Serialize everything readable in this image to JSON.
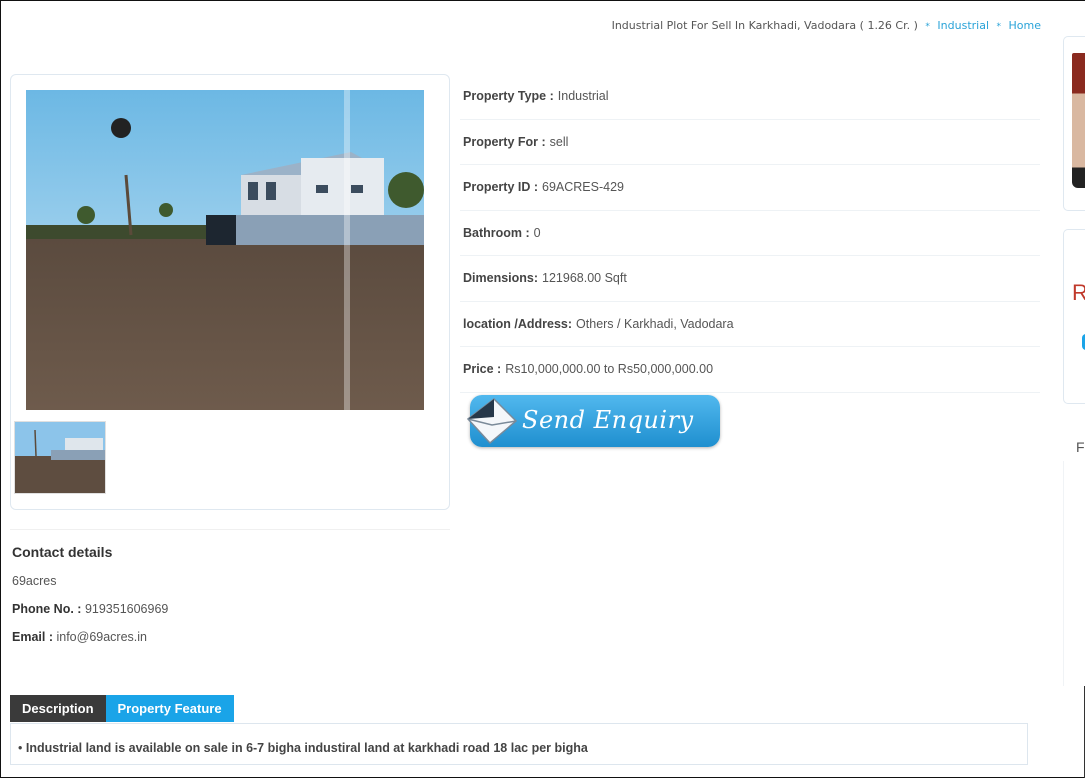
{
  "breadcrumb": {
    "current": "Industrial Plot For Sell In Karkhadi, Vadodara ( 1.26 Cr. )",
    "category": "Industrial",
    "home": "Home"
  },
  "details": [
    {
      "label": "Property Type :",
      "value": "Industrial"
    },
    {
      "label": "Property For :",
      "value": "sell"
    },
    {
      "label": "Property ID :",
      "value": "69ACRES-429"
    },
    {
      "label": "Bathroom :",
      "value": "0"
    },
    {
      "label": "Dimensions:",
      "value": "121968.00 Sqft"
    },
    {
      "label": "location /Address:",
      "value": "Others / Karkhadi, Vadodara"
    },
    {
      "label": "Price :",
      "value": "Rs10,000,000.00 to Rs50,000,000.00"
    }
  ],
  "enquiry": {
    "label": "Send Enquiry"
  },
  "contact": {
    "title": "Contact details",
    "name": "69acres",
    "phone_label": "Phone No. :",
    "phone": "919351606969",
    "email_label": "Email :",
    "email": "info@69acres.in"
  },
  "tabs": [
    {
      "label": "Description",
      "active": false
    },
    {
      "label": "Property Feature",
      "active": true
    }
  ],
  "features": [
    "Industrial land is available on sale in 6-7 bigha industiral land at karkhadi road 18 lac per bigha"
  ],
  "sidebar": {
    "letter_r": "R",
    "letter_p": "F"
  },
  "colors": {
    "accent": "#1aa4e8",
    "dark_tab": "#3a3a3a",
    "link": "#2aa3d8"
  }
}
